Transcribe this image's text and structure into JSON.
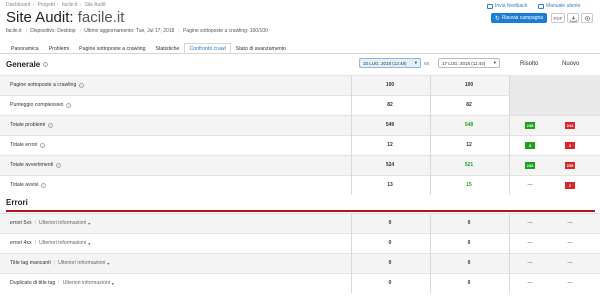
{
  "breadcrumb": [
    "Dashboard",
    "Progetti",
    "facile.it",
    "Site Audit"
  ],
  "title": {
    "prefix": "Site Audit:",
    "domain": "facile.it"
  },
  "meta": {
    "domain": "facile.it",
    "device": "Dispositivo: Desktop",
    "updated": "Ultimo aggiornamento: Tue, Jul 17, 2018",
    "crawled": "Pagine sottoposte a crawling: 100/100"
  },
  "header_actions": {
    "feedback": "Invia feedback",
    "manual": "Manuale utente",
    "rerun": "Riavvia campagna",
    "pdf": "PDF"
  },
  "tabs": [
    "Panoramica",
    "Problemi",
    "Pagine sottoposte a crawling",
    "Statistiche",
    "Confronto crawl",
    "Stato di avanzamento"
  ],
  "active_tab": "Confronto crawl",
  "compare": {
    "section": "Generale",
    "crawl_a": "10 LUG. 2018 (12:48)",
    "vs": "vs",
    "crawl_b": "17 LUG. 2018 (11:44)",
    "col_fixed": "Risolto",
    "col_new": "Nuovo"
  },
  "general_rows": [
    {
      "label": "Pagine sottoposte a crawling",
      "a": "100",
      "b": "100",
      "fixed": "",
      "new": ""
    },
    {
      "label": "Punteggio complessivo",
      "a": "82",
      "b": "82",
      "fixed": "",
      "new": ""
    },
    {
      "label": "Totale problemi",
      "a": "549",
      "b": "548",
      "fixed": "245",
      "new": "244"
    },
    {
      "label": "Totale errori",
      "a": "12",
      "b": "12",
      "fixed": "3",
      "new": "3"
    },
    {
      "label": "Totale avvertimenti",
      "a": "524",
      "b": "521",
      "fixed": "242",
      "new": "239"
    },
    {
      "label": "Totale avvisi",
      "a": "13",
      "b": "15",
      "fixed": "—",
      "new": "2"
    }
  ],
  "errors_section": "Errori",
  "more_label": "Ulteriori informazioni",
  "error_rows": [
    {
      "label": "errori 5xx",
      "a": "0",
      "b": "0",
      "fixed": "—",
      "new": "—"
    },
    {
      "label": "errori 4xx",
      "a": "0",
      "b": "0",
      "fixed": "—",
      "new": "—"
    },
    {
      "label": "Title tag mancanti",
      "a": "0",
      "b": "0",
      "fixed": "—",
      "new": "—"
    },
    {
      "label": "Duplicato di title tag",
      "a": "0",
      "b": "0",
      "fixed": "—",
      "new": "—"
    }
  ],
  "colors": {
    "accent": "#1b7cd6",
    "green": "#1aa31a",
    "red": "#d8262a",
    "section_rule": "#b5121b"
  }
}
